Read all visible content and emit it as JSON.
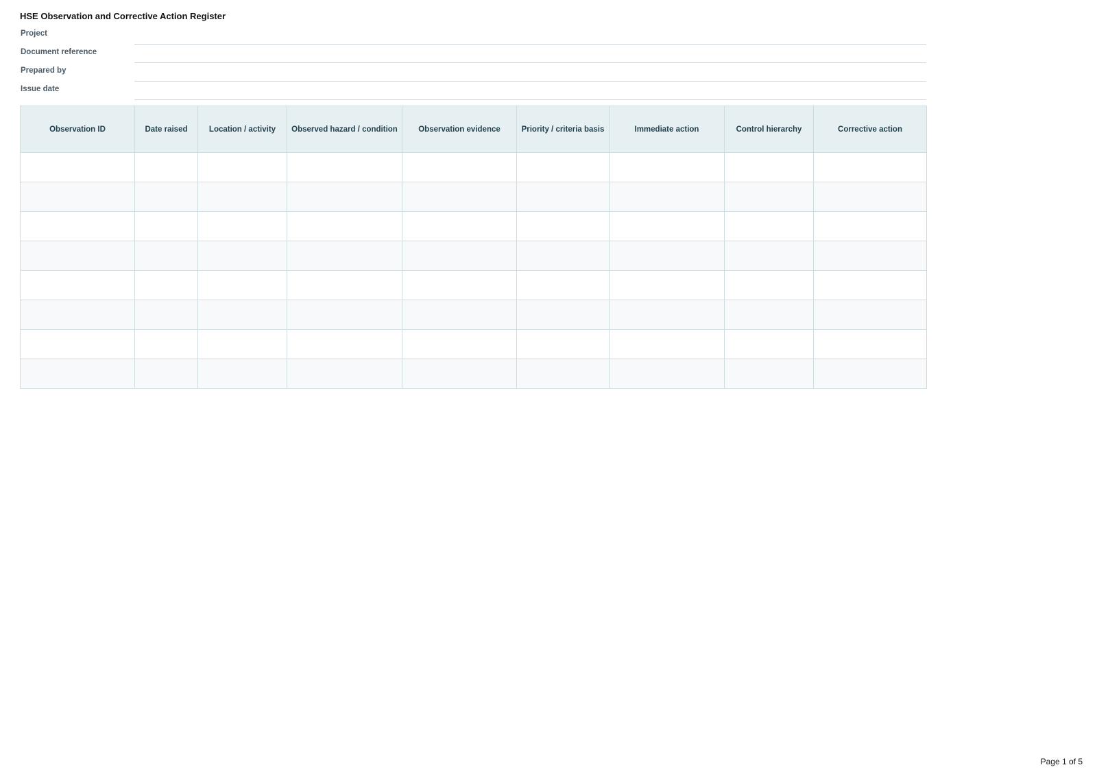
{
  "document": {
    "title": "HSE Observation and Corrective Action Register",
    "page_indicator": "Page 1 of 5"
  },
  "meta_fields": [
    {
      "label": "Project",
      "value": ""
    },
    {
      "label": "Document reference",
      "value": ""
    },
    {
      "label": "Prepared by",
      "value": ""
    },
    {
      "label": "Issue date",
      "value": ""
    }
  ],
  "register": {
    "columns": [
      "Observation ID",
      "Date raised",
      "Location / activity",
      "Observed hazard / condition",
      "Observation evidence",
      "Priority / criteria basis",
      "Immediate action",
      "Control hierarchy",
      "Corrective action"
    ],
    "rows": [
      [
        "",
        "",
        "",
        "",
        "",
        "",
        "",
        "",
        ""
      ],
      [
        "",
        "",
        "",
        "",
        "",
        "",
        "",
        "",
        ""
      ],
      [
        "",
        "",
        "",
        "",
        "",
        "",
        "",
        "",
        ""
      ],
      [
        "",
        "",
        "",
        "",
        "",
        "",
        "",
        "",
        ""
      ],
      [
        "",
        "",
        "",
        "",
        "",
        "",
        "",
        "",
        ""
      ],
      [
        "",
        "",
        "",
        "",
        "",
        "",
        "",
        "",
        ""
      ],
      [
        "",
        "",
        "",
        "",
        "",
        "",
        "",
        "",
        ""
      ],
      [
        "",
        "",
        "",
        "",
        "",
        "",
        "",
        "",
        ""
      ]
    ]
  },
  "colors": {
    "header_fill": "#e6f0f2",
    "header_text": "#23404d",
    "grid_line": "#cfdcdf",
    "stripe_fill": "#f7f9fa"
  }
}
